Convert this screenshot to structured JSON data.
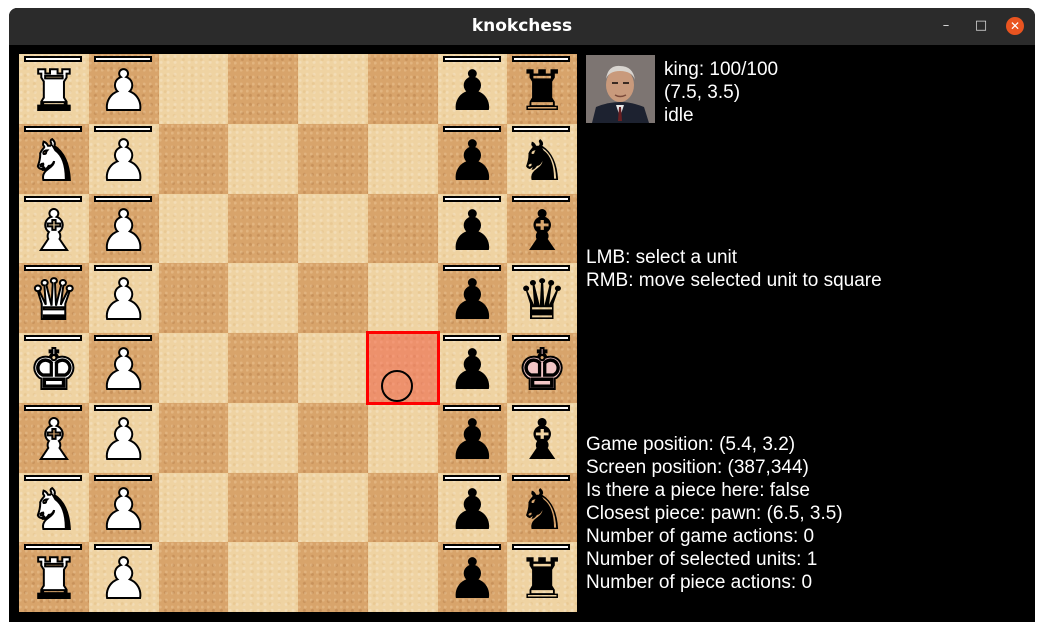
{
  "window": {
    "title": "knokchess",
    "buttons": {
      "minimize": "–",
      "maximize": "□",
      "close": "✕"
    }
  },
  "board": {
    "files": 8,
    "ranks": 8,
    "pieces": [
      {
        "col": 0,
        "row": 0,
        "color": "white",
        "type": "rook",
        "glyph": "♜"
      },
      {
        "col": 1,
        "row": 0,
        "color": "white",
        "type": "pawn",
        "glyph": "♟"
      },
      {
        "col": 6,
        "row": 0,
        "color": "black",
        "type": "pawn",
        "glyph": "♟"
      },
      {
        "col": 7,
        "row": 0,
        "color": "black",
        "type": "rook",
        "glyph": "♜"
      },
      {
        "col": 0,
        "row": 1,
        "color": "white",
        "type": "knight",
        "glyph": "♞"
      },
      {
        "col": 1,
        "row": 1,
        "color": "white",
        "type": "pawn",
        "glyph": "♟"
      },
      {
        "col": 6,
        "row": 1,
        "color": "black",
        "type": "pawn",
        "glyph": "♟"
      },
      {
        "col": 7,
        "row": 1,
        "color": "black",
        "type": "knight",
        "glyph": "♞"
      },
      {
        "col": 0,
        "row": 2,
        "color": "white",
        "type": "bishop",
        "glyph": "♝"
      },
      {
        "col": 1,
        "row": 2,
        "color": "white",
        "type": "pawn",
        "glyph": "♟"
      },
      {
        "col": 6,
        "row": 2,
        "color": "black",
        "type": "pawn",
        "glyph": "♟"
      },
      {
        "col": 7,
        "row": 2,
        "color": "black",
        "type": "bishop",
        "glyph": "♝"
      },
      {
        "col": 0,
        "row": 3,
        "color": "white",
        "type": "queen",
        "glyph": "♛"
      },
      {
        "col": 1,
        "row": 3,
        "color": "white",
        "type": "pawn",
        "glyph": "♟"
      },
      {
        "col": 6,
        "row": 3,
        "color": "black",
        "type": "pawn",
        "glyph": "♟"
      },
      {
        "col": 7,
        "row": 3,
        "color": "black",
        "type": "queen",
        "glyph": "♛"
      },
      {
        "col": 0,
        "row": 4,
        "color": "white",
        "type": "king",
        "glyph": "♚"
      },
      {
        "col": 1,
        "row": 4,
        "color": "white",
        "type": "pawn",
        "glyph": "♟"
      },
      {
        "col": 6,
        "row": 4,
        "color": "black",
        "type": "pawn",
        "glyph": "♟"
      },
      {
        "col": 7,
        "row": 4,
        "color": "black",
        "type": "king",
        "glyph": "♚",
        "selected": true
      },
      {
        "col": 0,
        "row": 5,
        "color": "white",
        "type": "bishop",
        "glyph": "♝"
      },
      {
        "col": 1,
        "row": 5,
        "color": "white",
        "type": "pawn",
        "glyph": "♟"
      },
      {
        "col": 6,
        "row": 5,
        "color": "black",
        "type": "pawn",
        "glyph": "♟"
      },
      {
        "col": 7,
        "row": 5,
        "color": "black",
        "type": "bishop",
        "glyph": "♝"
      },
      {
        "col": 0,
        "row": 6,
        "color": "white",
        "type": "knight",
        "glyph": "♞"
      },
      {
        "col": 1,
        "row": 6,
        "color": "white",
        "type": "pawn",
        "glyph": "♟"
      },
      {
        "col": 6,
        "row": 6,
        "color": "black",
        "type": "pawn",
        "glyph": "♟"
      },
      {
        "col": 7,
        "row": 6,
        "color": "black",
        "type": "knight",
        "glyph": "♞"
      },
      {
        "col": 0,
        "row": 7,
        "color": "white",
        "type": "rook",
        "glyph": "♜"
      },
      {
        "col": 1,
        "row": 7,
        "color": "white",
        "type": "pawn",
        "glyph": "♟"
      },
      {
        "col": 6,
        "row": 7,
        "color": "black",
        "type": "pawn",
        "glyph": "♟"
      },
      {
        "col": 7,
        "row": 7,
        "color": "black",
        "type": "rook",
        "glyph": "♜"
      }
    ],
    "highlight_square": {
      "col": 5,
      "row": 4,
      "color": "#ff0000"
    }
  },
  "unit_info": {
    "name_health": "king: 100/100",
    "position": "(7.5, 3.5)",
    "state": "idle"
  },
  "controls": {
    "lmb": "LMB: select a unit",
    "rmb": "RMB: move selected unit to square"
  },
  "debug": {
    "game_position": "Game position: (5.4, 3.2)",
    "screen_position": "Screen position: (387,344)",
    "piece_here": "Is there a piece here: false",
    "closest_piece": "Closest piece: pawn: (6.5, 3.5)",
    "game_actions": "Number of game actions: 0",
    "selected_units": "Number of selected units: 1",
    "piece_actions": "Number of piece actions: 0"
  }
}
